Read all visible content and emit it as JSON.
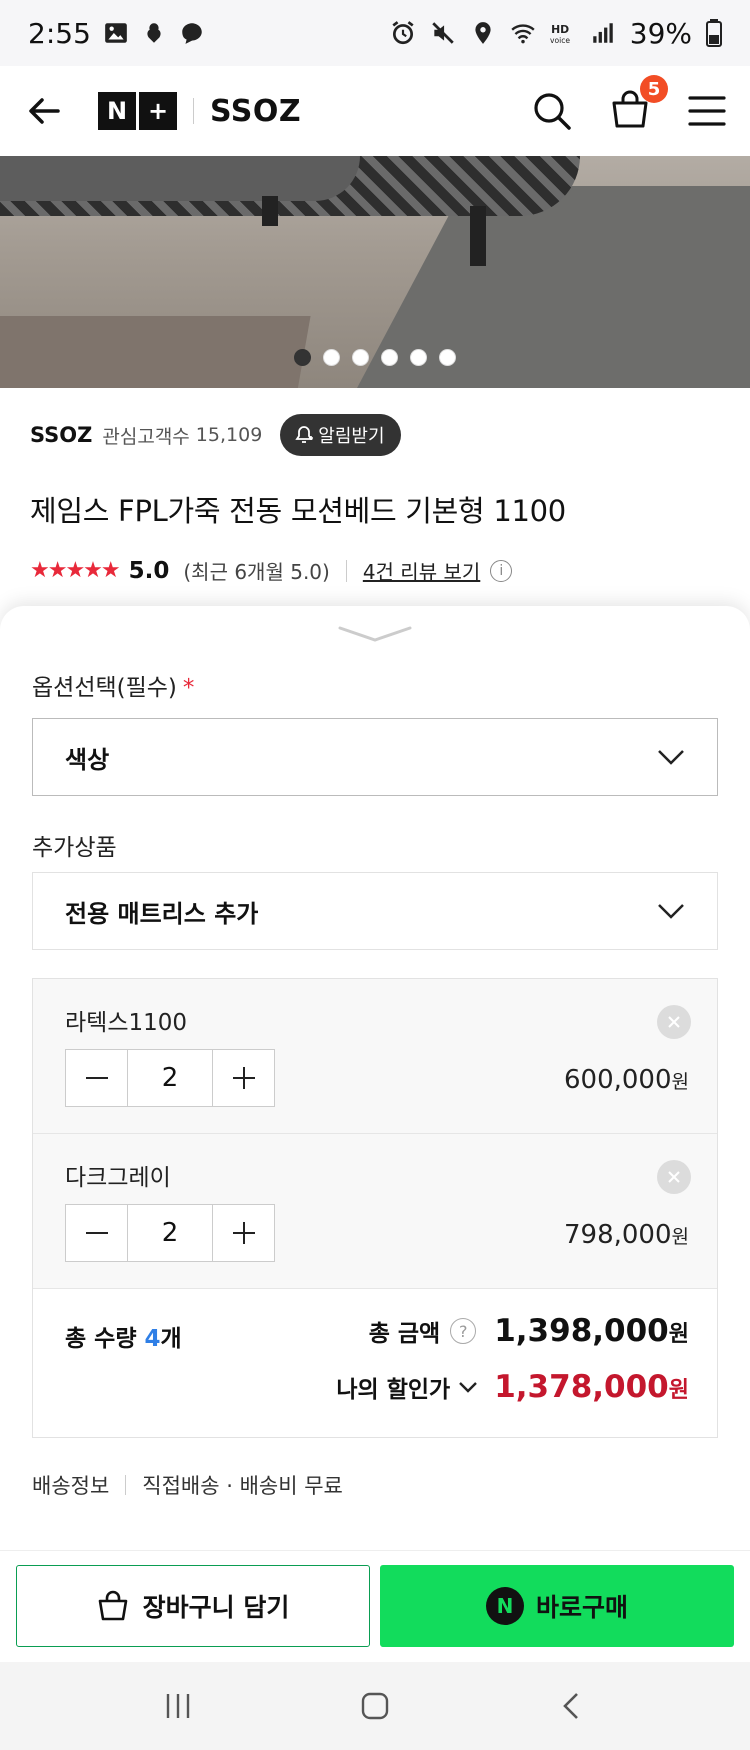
{
  "status_bar": {
    "time": "2:55",
    "battery": "39%"
  },
  "header": {
    "brand": "SSOZ",
    "cart_count": "5",
    "logo_left": "N",
    "logo_right": "+"
  },
  "hero": {
    "slides": 6,
    "active_slide": 1
  },
  "product": {
    "seller": "SSOZ",
    "fav_label": "관심고객수",
    "fav_count": "15,109",
    "alarm_label": "알림받기",
    "title": "제임스 FPL가죽 전동 모션베드 기본형 1100",
    "stars": "★★★★★",
    "rating": "5.0",
    "recent": "(최근 6개월 5.0)",
    "review_link": "4건 리뷰 보기"
  },
  "options": {
    "required_label": "옵션선택(필수)",
    "required_mark": "*",
    "color_select": "색상",
    "extra_label": "추가상품",
    "extra_select": "전용 매트리스 추가"
  },
  "cart_items": [
    {
      "name": "라텍스1100",
      "qty": "2",
      "price": "600,000",
      "unit": "원"
    },
    {
      "name": "다크그레이",
      "qty": "2",
      "price": "798,000",
      "unit": "원"
    }
  ],
  "summary": {
    "qty_label": "총 수량",
    "qty_count": "4",
    "qty_suffix": "개",
    "total_label": "총 금액",
    "total": "1,398,000",
    "disc_label": "나의 할인가",
    "discounted": "1,378,000",
    "unit": "원"
  },
  "shipping": {
    "label": "배송정보",
    "value": "직접배송 · 배송비 무료"
  },
  "actions": {
    "cart_label": "장바구니 담기",
    "buy_label": "바로구매",
    "npay_mark": "N"
  },
  "colors": {
    "buy_green": "#12dc5c",
    "price_red": "#c4172d",
    "star_red": "#e8293a",
    "badge_orange": "#f24d25"
  }
}
